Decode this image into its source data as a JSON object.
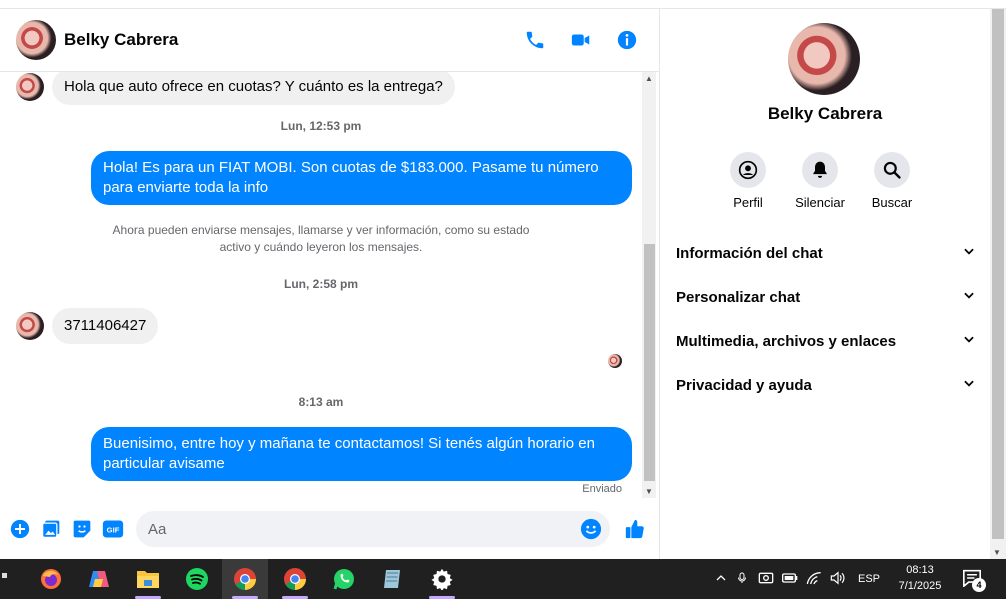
{
  "contact": {
    "name": "Belky Cabrera"
  },
  "messages": {
    "incoming_1": "Hola que auto ofrece en cuotas? Y cuánto es la entrega?",
    "ts_1": "Lun, 12:53 pm",
    "outgoing_1": "Hola! Es para un FIAT MOBI. Son cuotas de $183.000. Pasame tu número para enviarte toda la info",
    "system_note": "Ahora pueden enviarse mensajes, llamarse y ver información, como su estado activo y cuándo leyeron los mensajes.",
    "ts_2": "Lun, 2:58 pm",
    "incoming_2": "3711406427",
    "ts_3": "8:13 am",
    "outgoing_2": "Buenisimo, entre hoy y mañana te contactamos! Si tenés algún horario en particular avisame",
    "status": "Enviado"
  },
  "composer": {
    "placeholder": "Aa"
  },
  "info_panel": {
    "name": "Belky Cabrera",
    "actions": [
      {
        "label": "Perfil",
        "icon": "profile-icon"
      },
      {
        "label": "Silenciar",
        "icon": "bell-icon"
      },
      {
        "label": "Buscar",
        "icon": "search-icon"
      }
    ],
    "sections": [
      "Información del chat",
      "Personalizar chat",
      "Multimedia, archivos y enlaces",
      "Privacidad y ayuda"
    ]
  },
  "taskbar": {
    "language": "ESP",
    "time": "08:13",
    "date": "7/1/2025",
    "notifications": "4"
  },
  "colors": {
    "accent": "#0084ff",
    "bubble_in": "#f0f0f0",
    "taskbar": "#202020"
  }
}
